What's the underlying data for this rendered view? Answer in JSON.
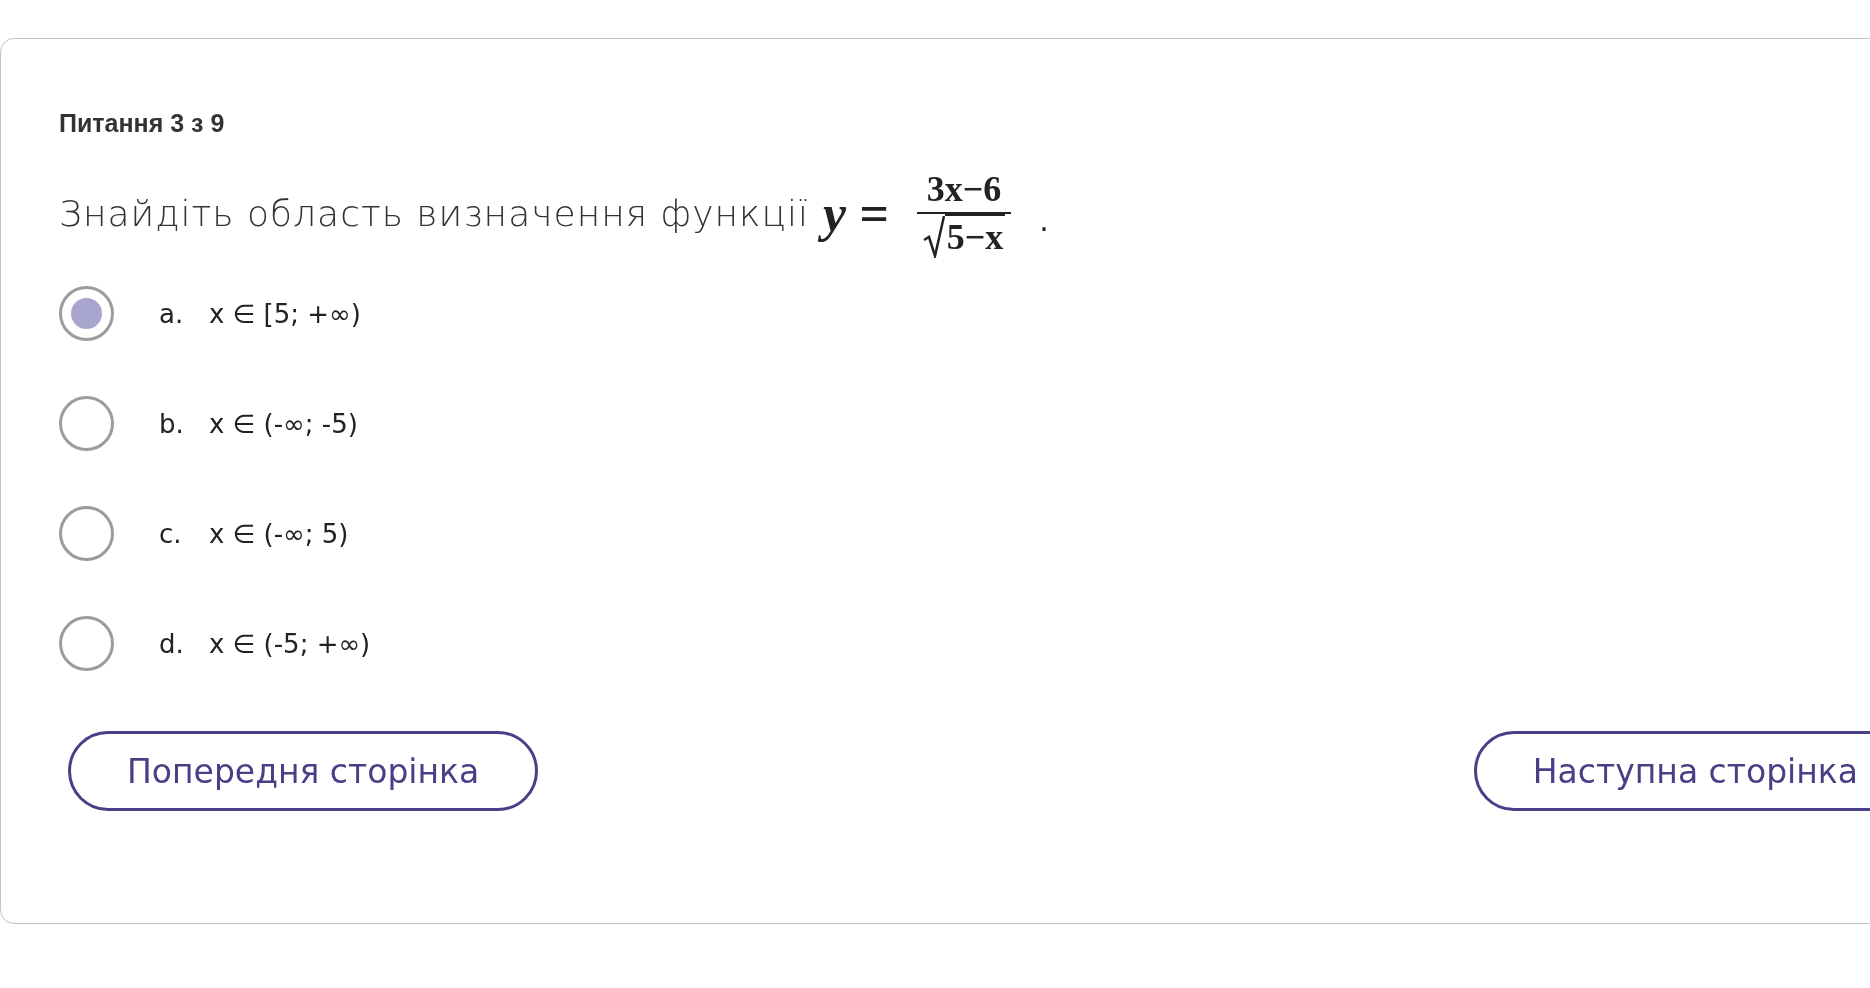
{
  "question_header": "Питання 3 з 9",
  "question": {
    "text": "Знайдіть область визначення функції",
    "formula": {
      "lhs": "y =",
      "numerator": "3x−6",
      "radicand": "5−x"
    },
    "end": "."
  },
  "options": [
    {
      "letter": "a.",
      "text": "x ∈ [5; +∞)",
      "selected": true
    },
    {
      "letter": "b.",
      "text": "x ∈ (-∞; -5)",
      "selected": false
    },
    {
      "letter": "c.",
      "text": "x ∈ (-∞; 5)",
      "selected": false
    },
    {
      "letter": "d.",
      "text": "x ∈ (-5; +∞)",
      "selected": false
    }
  ],
  "buttons": {
    "previous": "Попередня сторінка",
    "next": "Наступна сторінка"
  }
}
